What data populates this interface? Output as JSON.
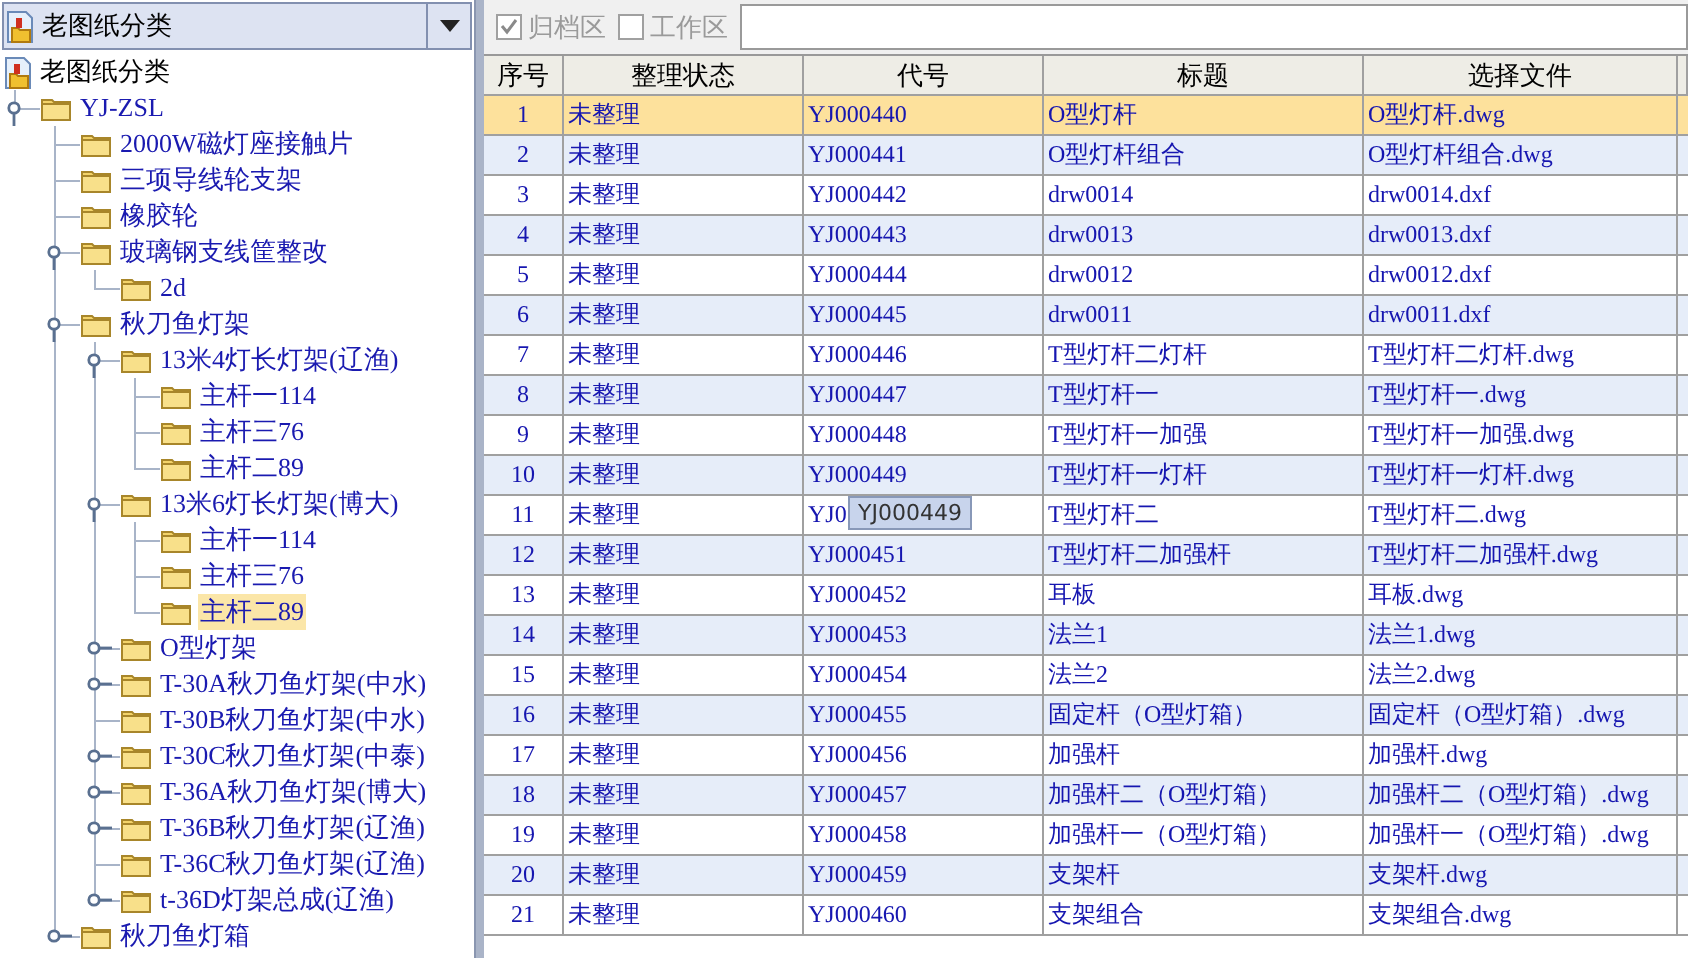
{
  "combo": {
    "value": "老图纸分类"
  },
  "tree": {
    "root": "老图纸分类",
    "children": [
      {
        "label": "YJ-ZSL",
        "expanded": true,
        "selected": false,
        "children": [
          {
            "label": "2000W磁灯座接触片",
            "selected": false
          },
          {
            "label": "三项导线轮支架",
            "selected": false
          },
          {
            "label": "橡胶轮",
            "selected": false
          },
          {
            "label": "玻璃钢支线筐整改",
            "expanded": true,
            "selected": false,
            "children": [
              {
                "label": "2d",
                "selected": false
              }
            ]
          },
          {
            "label": "秋刀鱼灯架",
            "expanded": true,
            "selected": false,
            "children": [
              {
                "label": "13米4灯长灯架(辽渔)",
                "expanded": true,
                "selected": false,
                "children": [
                  {
                    "label": "主杆一114",
                    "selected": false
                  },
                  {
                    "label": "主杆三76",
                    "selected": false
                  },
                  {
                    "label": "主杆二89",
                    "selected": false
                  }
                ]
              },
              {
                "label": "13米6灯长灯架(博大)",
                "expanded": true,
                "selected": false,
                "children": [
                  {
                    "label": "主杆一114",
                    "selected": false
                  },
                  {
                    "label": "主杆三76",
                    "selected": false
                  },
                  {
                    "label": "主杆二89",
                    "selected": true
                  }
                ]
              },
              {
                "label": "O型灯架",
                "expanded": false,
                "selected": false
              },
              {
                "label": "T-30A秋刀鱼灯架(中水)",
                "expanded": false,
                "selected": false
              },
              {
                "label": "T-30B秋刀鱼灯架(中水)",
                "selected": false
              },
              {
                "label": "T-30C秋刀鱼灯架(中泰)",
                "expanded": false,
                "selected": false
              },
              {
                "label": "T-36A秋刀鱼灯架(博大)",
                "expanded": false,
                "selected": false
              },
              {
                "label": "T-36B秋刀鱼灯架(辽渔)",
                "expanded": false,
                "selected": false
              },
              {
                "label": "T-36C秋刀鱼灯架(辽渔)",
                "selected": false
              },
              {
                "label": "t-36D灯架总成(辽渔)",
                "expanded": false,
                "selected": false
              }
            ]
          },
          {
            "label": "秋刀鱼灯箱",
            "expanded": false,
            "selected": false
          }
        ]
      }
    ]
  },
  "toolbar": {
    "checkboxes": [
      {
        "label": "归档区",
        "checked": true,
        "disabled": true
      },
      {
        "label": "工作区",
        "checked": false,
        "disabled": true
      }
    ]
  },
  "table": {
    "columns": [
      "序号",
      "整理状态",
      "代号",
      "标题",
      "选择文件"
    ],
    "rows": [
      {
        "cells": [
          "1",
          "未整理",
          "YJ000440",
          "O型灯杆",
          "O型灯杆.dwg"
        ],
        "selected": true
      },
      {
        "cells": [
          "2",
          "未整理",
          "YJ000441",
          "O型灯杆组合",
          "O型灯杆组合.dwg"
        ],
        "selected": false
      },
      {
        "cells": [
          "3",
          "未整理",
          "YJ000442",
          "drw0014",
          "drw0014.dxf"
        ],
        "selected": false
      },
      {
        "cells": [
          "4",
          "未整理",
          "YJ000443",
          "drw0013",
          "drw0013.dxf"
        ],
        "selected": false
      },
      {
        "cells": [
          "5",
          "未整理",
          "YJ000444",
          "drw0012",
          "drw0012.dxf"
        ],
        "selected": false
      },
      {
        "cells": [
          "6",
          "未整理",
          "YJ000445",
          "drw0011",
          "drw0011.dxf"
        ],
        "selected": false
      },
      {
        "cells": [
          "7",
          "未整理",
          "YJ000446",
          "T型灯杆二灯杆",
          "T型灯杆二灯杆.dwg"
        ],
        "selected": false
      },
      {
        "cells": [
          "8",
          "未整理",
          "YJ000447",
          "T型灯杆一",
          "T型灯杆一.dwg"
        ],
        "selected": false
      },
      {
        "cells": [
          "9",
          "未整理",
          "YJ000448",
          "T型灯杆一加强",
          "T型灯杆一加强.dwg"
        ],
        "selected": false
      },
      {
        "cells": [
          "10",
          "未整理",
          "YJ000449",
          "T型灯杆一灯杆",
          "T型灯杆一灯杆.dwg"
        ],
        "selected": false
      },
      {
        "cells": [
          "11",
          "未整理",
          "YJ0",
          "T型灯杆二",
          "T型灯杆二.dwg"
        ],
        "selected": false
      },
      {
        "cells": [
          "12",
          "未整理",
          "YJ000451",
          "T型灯杆二加强杆",
          "T型灯杆二加强杆.dwg"
        ],
        "selected": false
      },
      {
        "cells": [
          "13",
          "未整理",
          "YJ000452",
          "耳板",
          "耳板.dwg"
        ],
        "selected": false
      },
      {
        "cells": [
          "14",
          "未整理",
          "YJ000453",
          "法兰1",
          "法兰1.dwg"
        ],
        "selected": false
      },
      {
        "cells": [
          "15",
          "未整理",
          "YJ000454",
          "法兰2",
          "法兰2.dwg"
        ],
        "selected": false
      },
      {
        "cells": [
          "16",
          "未整理",
          "YJ000455",
          "固定杆（O型灯箱）",
          "固定杆（O型灯箱）.dwg"
        ],
        "selected": false
      },
      {
        "cells": [
          "17",
          "未整理",
          "YJ000456",
          "加强杆",
          "加强杆.dwg"
        ],
        "selected": false
      },
      {
        "cells": [
          "18",
          "未整理",
          "YJ000457",
          "加强杆二（O型灯箱）",
          "加强杆二（O型灯箱）.dwg"
        ],
        "selected": false
      },
      {
        "cells": [
          "19",
          "未整理",
          "YJ000458",
          "加强杆一（O型灯箱）",
          "加强杆一（O型灯箱）.dwg"
        ],
        "selected": false
      },
      {
        "cells": [
          "20",
          "未整理",
          "YJ000459",
          "支架杆",
          "支架杆.dwg"
        ],
        "selected": false
      },
      {
        "cells": [
          "21",
          "未整理",
          "YJ000460",
          "支架组合",
          "支架组合.dwg"
        ],
        "selected": false
      }
    ]
  },
  "tooltip": {
    "text": "YJ000449"
  }
}
